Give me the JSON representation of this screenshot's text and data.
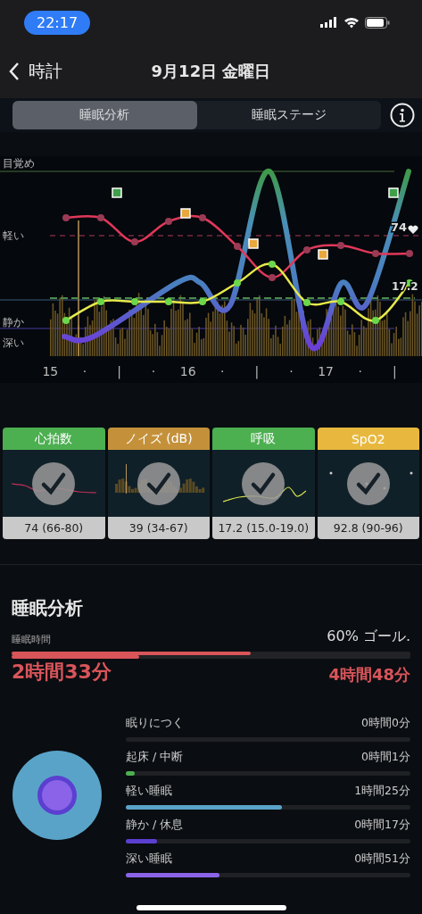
{
  "status_bar": {
    "time": "22:17"
  },
  "nav": {
    "back": "時計",
    "title": "9月12日 金曜日"
  },
  "tabs": [
    {
      "label": "睡眠分析",
      "selected": true
    },
    {
      "label": "睡眠ステージ",
      "selected": false
    }
  ],
  "chart": {
    "stage_labels": [
      "目覚め",
      "軽い",
      "静か",
      "深い"
    ],
    "x_labels": [
      "15",
      "·",
      "|",
      "·",
      "16",
      "·",
      "|",
      "·",
      "17",
      "·",
      "|"
    ],
    "heart_reading": "74",
    "breath_reading": "17.2"
  },
  "metrics": [
    {
      "title": "心拍数",
      "color": "#4caf50",
      "summary": "74 (66-80)",
      "checked": true
    },
    {
      "title": "ノイズ (dB)",
      "color": "#c4913a",
      "summary": "39 (34-67)",
      "checked": true
    },
    {
      "title": "呼吸",
      "color": "#4caf50",
      "summary": "17.2 (15.0-19.0)",
      "checked": true
    },
    {
      "title": "SpO2",
      "color": "#e8b83e",
      "summary": "92.8 (90-96)",
      "checked": true
    }
  ],
  "analysis": {
    "title": "睡眠分析",
    "subtitle": "睡眠時間",
    "goal": "60% ゴール.",
    "progress": [
      {
        "level": 0.6
      },
      {
        "level": 0.32
      }
    ],
    "actual": "2時間33分",
    "target": "4時間48分"
  },
  "stages": [
    {
      "label": "眠りにつく",
      "value": "0時間0分"
    },
    {
      "label": "起床 / 中断",
      "value": "0時間1分",
      "level": 0.03,
      "color": "#4caf50"
    },
    {
      "label": "軽い睡眠",
      "value": "1時間25分",
      "level": 0.55,
      "color": "#5aa3c8"
    },
    {
      "label": "静か / 休息",
      "value": "0時間17分",
      "level": 0.11,
      "color": "#5b3fd0"
    },
    {
      "label": "深い睡眠",
      "value": "0時間51分",
      "level": 0.33,
      "color": "#8a63e8"
    }
  ]
}
